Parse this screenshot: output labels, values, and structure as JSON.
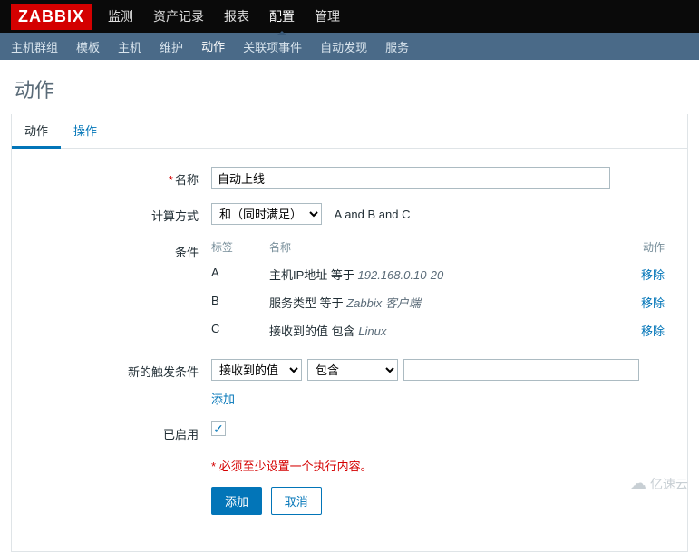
{
  "logo": "ZABBIX",
  "topnav": {
    "items": [
      "监测",
      "资产记录",
      "报表",
      "配置",
      "管理"
    ],
    "active_index": 3
  },
  "subnav": {
    "items": [
      "主机群组",
      "模板",
      "主机",
      "维护",
      "动作",
      "关联项事件",
      "自动发现",
      "服务"
    ],
    "active_index": 4
  },
  "page_title": "动作",
  "tabs": {
    "items": [
      "动作",
      "操作"
    ],
    "active_index": 0
  },
  "form": {
    "name_label": "名称",
    "name_value": "自动上线",
    "calc_label": "计算方式",
    "calc_value": "和（同时满足）",
    "formula": "A and B and C",
    "cond_label": "条件",
    "cond_headers": {
      "tag": "标签",
      "name": "名称",
      "action": "动作"
    },
    "conditions": [
      {
        "tag": "A",
        "text": "主机IP地址 等于 ",
        "italic": "192.168.0.10-20",
        "action": "移除"
      },
      {
        "tag": "B",
        "text": "服务类型 等于 ",
        "italic": "Zabbix 客户端",
        "action": "移除"
      },
      {
        "tag": "C",
        "text": "接收到的值 包含 ",
        "italic": "Linux",
        "action": "移除"
      }
    ],
    "trigger_label": "新的触发条件",
    "trigger_type": "接收到的值",
    "trigger_op": "包含",
    "trigger_add": "添加",
    "enabled_label": "已启用",
    "warning": "必须至少设置一个执行内容。",
    "submit": "添加",
    "cancel": "取消"
  },
  "watermark": "亿速云"
}
